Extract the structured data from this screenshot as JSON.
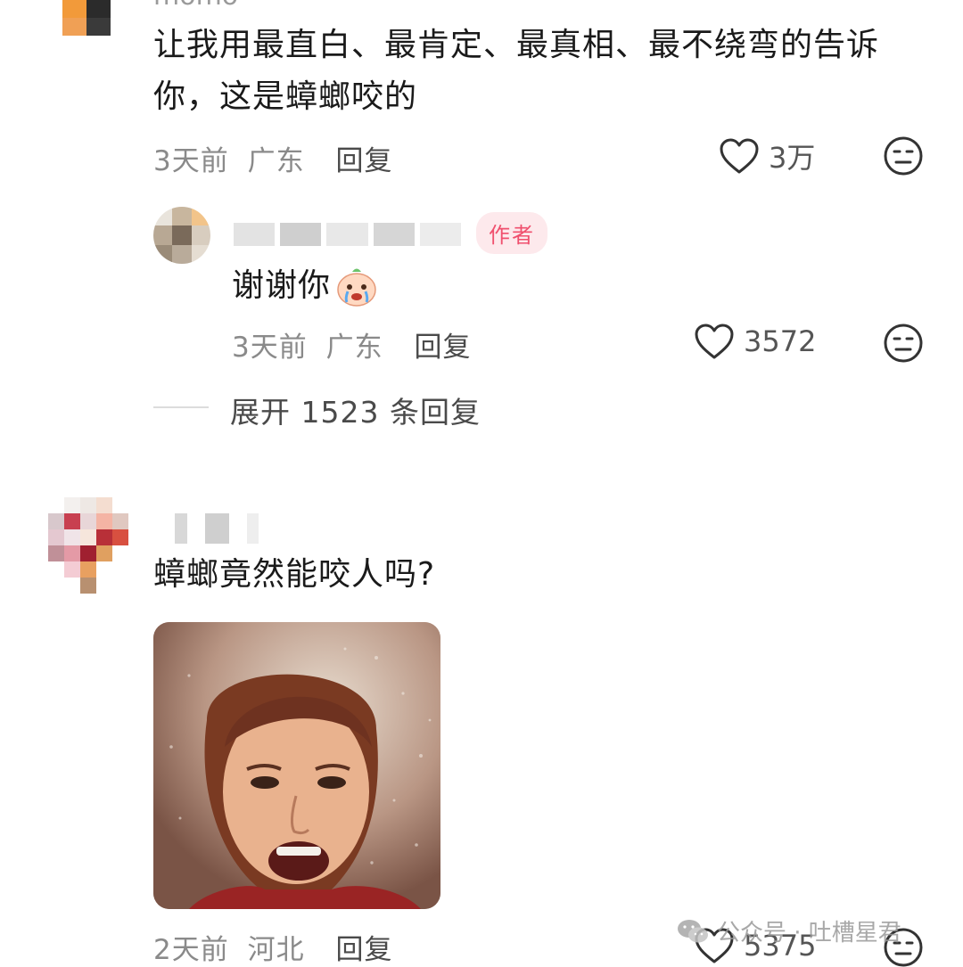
{
  "comment1": {
    "username_partial": "momo",
    "text_line1": "让我用最直白、最肯定、最真相、最不绕弯的告诉",
    "text_line2": "你，这是蟑螂咬的",
    "time": "3天前",
    "location": "广东",
    "reply_label": "回复",
    "likes": "3万"
  },
  "reply1": {
    "author_badge": "作者",
    "text": "谢谢你",
    "time": "3天前",
    "location": "广东",
    "reply_label": "回复",
    "likes": "3572"
  },
  "expand": {
    "label": "展开 1523 条回复"
  },
  "comment2": {
    "text": "蟑螂竟然能咬人吗?",
    "time": "2天前",
    "location": "河北",
    "reply_label": "回复",
    "likes": "5375"
  },
  "watermark": {
    "text": "公众号 · 吐槽星君"
  },
  "colors": {
    "badge_bg": "#fde9ec",
    "badge_text": "#f0506e",
    "meta_text": "#8a8a8a"
  }
}
